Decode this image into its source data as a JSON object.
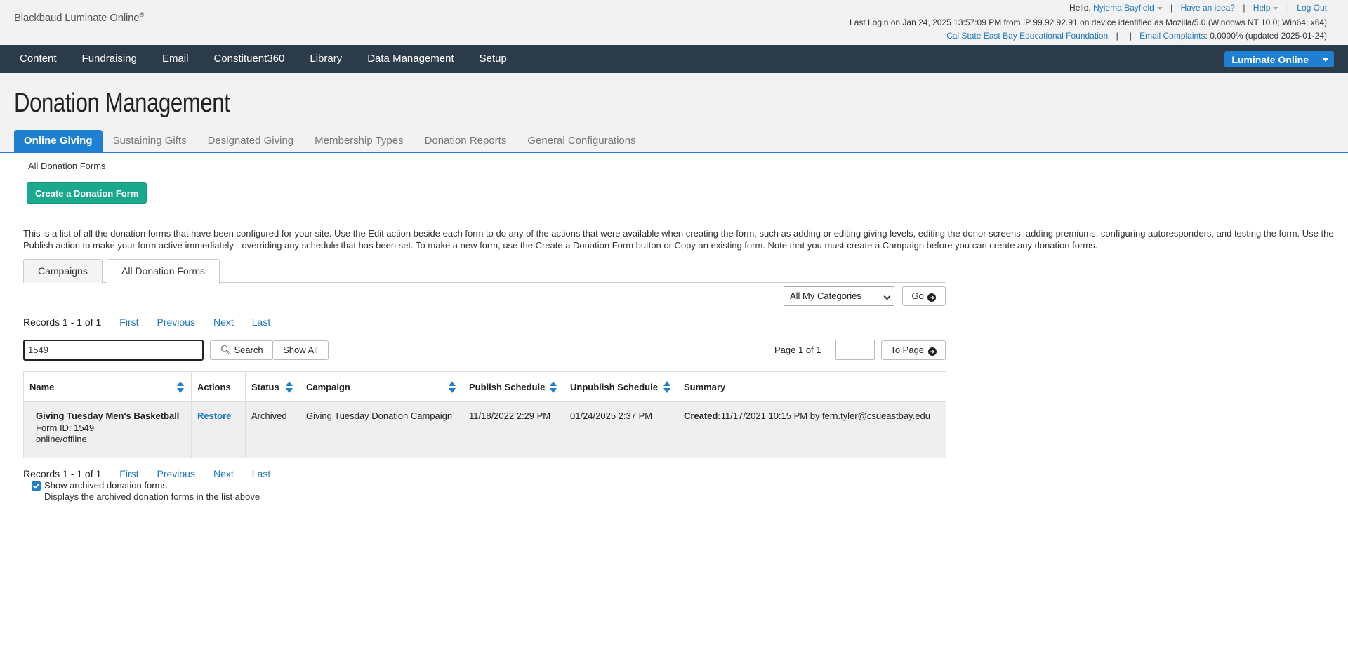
{
  "brand": {
    "name": "Blackbaud Luminate Online",
    "mark": "®"
  },
  "user": {
    "hello": "Hello,",
    "name": "Nyiema Bayfield",
    "idea": "Have an idea?",
    "help": "Help",
    "logout": "Log Out",
    "last_login": "Last Login on Jan 24, 2025 13:57:09 PM from IP 99.92.92.91 on device identified as Mozilla/5.0 (Windows NT 10.0; Win64; x64)",
    "org": "Cal State East Bay Educational Foundation",
    "complaints_label": "Email Complaints",
    "complaints_value": ": 0.0000% (updated 2025-01-24)"
  },
  "nav": {
    "items": [
      "Content",
      "Fundraising",
      "Email",
      "Constituent360",
      "Library",
      "Data Management",
      "Setup"
    ],
    "luminate_button": "Luminate Online"
  },
  "page": {
    "title": "Donation Management",
    "tabs": [
      "Online Giving",
      "Sustaining Gifts",
      "Designated Giving",
      "Membership Types",
      "Donation Reports",
      "General Configurations"
    ],
    "breadcrumb": "All Donation Forms",
    "create_button": "Create a Donation Form",
    "description": "This is a list of all the donation forms that have been configured for your site. Use the Edit action beside each form to do any of the actions that were available when creating the form, such as adding or editing giving levels, editing the donor screens, adding premiums, configuring autoresponders, and testing the form. Use the Publish action to make your form active immediately - overriding any schedule that has been set. To make a new form, use the Create a Donation Form button or Copy an existing form. Note that you must create a Campaign before you can create any donation forms."
  },
  "form_tabs": [
    "Campaigns",
    "All Donation Forms"
  ],
  "filter": {
    "category": "All My Categories",
    "go": "Go"
  },
  "pager": {
    "records": "Records 1 - 1 of 1",
    "first": "First",
    "previous": "Previous",
    "next": "Next",
    "last": "Last"
  },
  "search": {
    "value": "1549",
    "search_button": "Search",
    "show_all": "Show All",
    "page_info": "Page 1 of 1",
    "to_page": "To Page"
  },
  "table": {
    "headers": [
      "Name",
      "Actions",
      "Status",
      "Campaign",
      "Publish Schedule",
      "Unpublish Schedule",
      "Summary"
    ],
    "rows": [
      {
        "name": "Giving Tuesday Men's Basketball",
        "form_id": "Form ID: 1549",
        "mode": "online/offline",
        "action": "Restore",
        "status": "Archived",
        "campaign": "Giving Tuesday Donation Campaign",
        "publish": "11/18/2022 2:29 PM",
        "unpublish": "01/24/2025 2:37 PM",
        "summary_label": "Created:",
        "summary_value": "11/17/2021 10:15 PM by fern.tyler@csueastbay.edu"
      }
    ]
  },
  "archived": {
    "label": "Show archived donation forms",
    "description": "Displays the archived donation forms in the list above",
    "checked": true
  },
  "colors": {
    "nav_bg": "#2b3b4a",
    "accent": "#1f7fd0",
    "create": "#1aa98c",
    "link": "#1f77bc"
  }
}
